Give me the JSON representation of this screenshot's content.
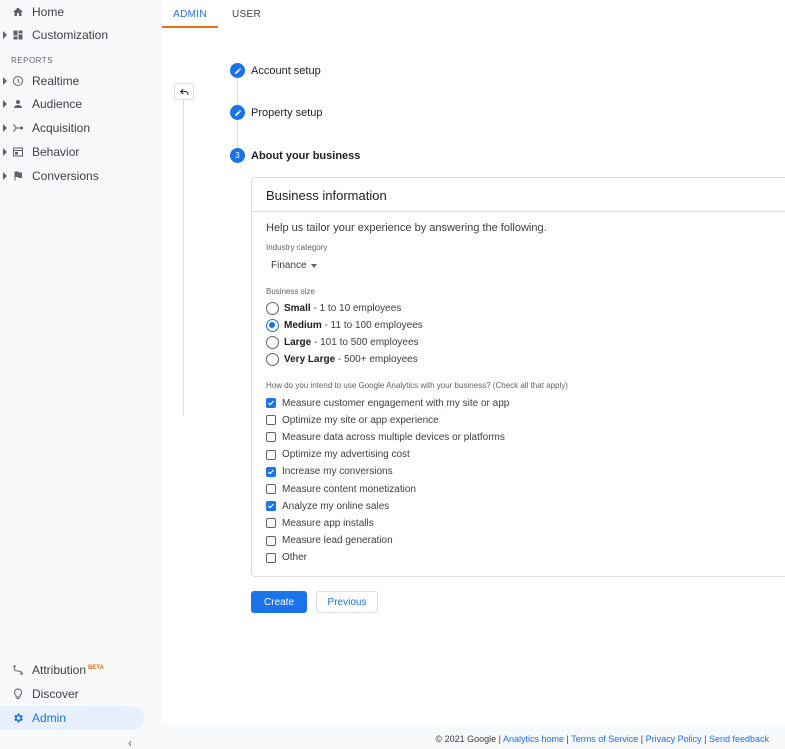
{
  "sidebar": {
    "items": [
      {
        "label": "Home",
        "icon": "home-icon"
      },
      {
        "label": "Customization",
        "icon": "dashboard-icon"
      },
      {
        "label": "Realtime",
        "icon": "clock-icon"
      },
      {
        "label": "Audience",
        "icon": "person-icon"
      },
      {
        "label": "Acquisition",
        "icon": "acquisition-icon"
      },
      {
        "label": "Behavior",
        "icon": "behavior-icon"
      },
      {
        "label": "Conversions",
        "icon": "flag-icon"
      }
    ],
    "reports_label": "REPORTS",
    "bottom": {
      "attribution": "Attribution",
      "beta": "BETA",
      "discover": "Discover",
      "admin": "Admin"
    },
    "collapse": "‹"
  },
  "tabs": {
    "admin": "ADMIN",
    "user": "USER"
  },
  "steps": {
    "account": "Account setup",
    "property": "Property setup",
    "about_num": "3",
    "about": "About your business"
  },
  "card": {
    "title": "Business information",
    "intro": "Help us tailor your experience by answering the following.",
    "industry_label": "Industry category",
    "industry_value": "Finance",
    "size_label": "Business size",
    "sizes": [
      {
        "bold": "Small",
        "rest": " - 1 to 10 employees",
        "selected": false
      },
      {
        "bold": "Medium",
        "rest": " - 11 to 100 employees",
        "selected": true
      },
      {
        "bold": "Large",
        "rest": " - 101 to 500 employees",
        "selected": false
      },
      {
        "bold": "Very Large",
        "rest": " - 500+ employees",
        "selected": false
      }
    ],
    "use_label": "How do you intend to use Google Analytics with your business? (Check all that apply)",
    "uses": [
      {
        "label": "Measure customer engagement with my site or app",
        "checked": true
      },
      {
        "label": "Optimize my site or app experience",
        "checked": false
      },
      {
        "label": "Measure data across multiple devices or platforms",
        "checked": false
      },
      {
        "label": "Optimize my advertising cost",
        "checked": false
      },
      {
        "label": "Increase my conversions",
        "checked": true
      },
      {
        "label": "Measure content monetization",
        "checked": false
      },
      {
        "label": "Analyze my online sales",
        "checked": true
      },
      {
        "label": "Measure app installs",
        "checked": false
      },
      {
        "label": "Measure lead generation",
        "checked": false
      },
      {
        "label": "Other",
        "checked": false
      }
    ]
  },
  "buttons": {
    "create": "Create",
    "previous": "Previous"
  },
  "footer": {
    "copyright": "© 2021 Google",
    "sep": " | ",
    "home": "Analytics home",
    "terms": "Terms of Service",
    "privacy": "Privacy Policy",
    "feedback": "Send feedback"
  },
  "colors": {
    "accent": "#1a73e8",
    "tab_underline": "#e8710a",
    "sidebar_bg": "#f8f9fa"
  }
}
